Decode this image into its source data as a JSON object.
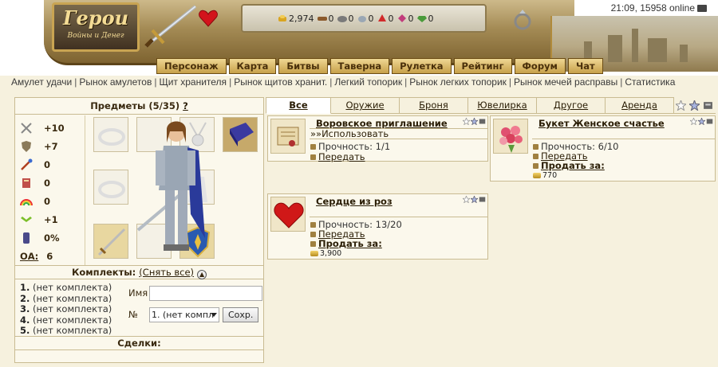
{
  "header": {
    "logo_title": "Герои",
    "logo_subtitle": "Войны и Денег",
    "clock": "21:09, 15958 online",
    "resources": [
      {
        "name": "gold",
        "icon": "gold-icon",
        "value": "2,974",
        "color": "#d9a520"
      },
      {
        "name": "wood",
        "icon": "wood-icon",
        "value": "0",
        "color": "#8b5a2b"
      },
      {
        "name": "ore",
        "icon": "ore-icon",
        "value": "0",
        "color": "#7a7a7a"
      },
      {
        "name": "mercury",
        "icon": "mercury-icon",
        "value": "0",
        "color": "#9aa7b4"
      },
      {
        "name": "sulfur",
        "icon": "sulfur-icon",
        "value": "0",
        "color": "#d12a2a"
      },
      {
        "name": "crystal",
        "icon": "crystal-icon",
        "value": "0",
        "color": "#c23c7c"
      },
      {
        "name": "gems",
        "icon": "gems-icon",
        "value": "0",
        "color": "#4a9a3a"
      }
    ]
  },
  "nav": [
    {
      "label": "Персонаж"
    },
    {
      "label": "Карта"
    },
    {
      "label": "Битвы"
    },
    {
      "label": "Таверна"
    },
    {
      "label": "Рулетка"
    },
    {
      "label": "Рейтинг"
    },
    {
      "label": "Форум"
    },
    {
      "label": "Чат"
    }
  ],
  "links": [
    "Амулет удачи",
    "Рынок амулетов",
    "Щит хранителя",
    "Рынок щитов хранит.",
    "Легкий топорик",
    "Рынок легких топорик",
    "Рынок мечей расправы",
    "Статистика"
  ],
  "left": {
    "items_title": "Предметы (5/35)",
    "items_help": "?",
    "stats": [
      {
        "icon": "attack-icon",
        "value": "+10"
      },
      {
        "icon": "defense-icon",
        "value": "+7"
      },
      {
        "icon": "spellpower-icon",
        "value": "0"
      },
      {
        "icon": "knowledge-icon",
        "value": "0"
      },
      {
        "icon": "luck-icon",
        "value": "0"
      },
      {
        "icon": "morale-icon",
        "value": "+1"
      },
      {
        "icon": "initiative-icon",
        "value": "0%"
      },
      {
        "icon": "oa-label",
        "value": "6",
        "label": "ОА:"
      }
    ],
    "sets_title": "Комплекты:",
    "sets_remove_all": "(Снять все)",
    "sets": [
      {
        "num": "1.",
        "text": "(нет комплекта)"
      },
      {
        "num": "2.",
        "text": "(нет комплекта)"
      },
      {
        "num": "3.",
        "text": "(нет комплекта)"
      },
      {
        "num": "4.",
        "text": "(нет комплекта)"
      },
      {
        "num": "5.",
        "text": "(нет комплекта)"
      }
    ],
    "form_name_label": "Имя",
    "form_num_label": "№",
    "form_select_value": "1. (нет компл",
    "form_save": "Сохр.",
    "deals_title": "Сделки:"
  },
  "tabs": [
    {
      "label": "Все",
      "active": true
    },
    {
      "label": "Оружие",
      "active": false
    },
    {
      "label": "Броня",
      "active": false
    },
    {
      "label": "Ювелирка",
      "active": false
    },
    {
      "label": "Другое",
      "active": false
    },
    {
      "label": "Аренда",
      "active": false
    }
  ],
  "cards": [
    {
      "title": "Воровское приглашение",
      "action": "»»Использовать",
      "durability": "Прочность: 1/1",
      "transfer": "Передать"
    },
    {
      "title": "Букет Женское счастье",
      "durability": "Прочность: 6/10",
      "transfer": "Передать",
      "sell": "Продать за:",
      "price": "770"
    },
    {
      "title": "Сердце из роз",
      "durability": "Прочность: 13/20",
      "transfer": "Передать",
      "sell": "Продать за:",
      "price": "3,900"
    }
  ]
}
